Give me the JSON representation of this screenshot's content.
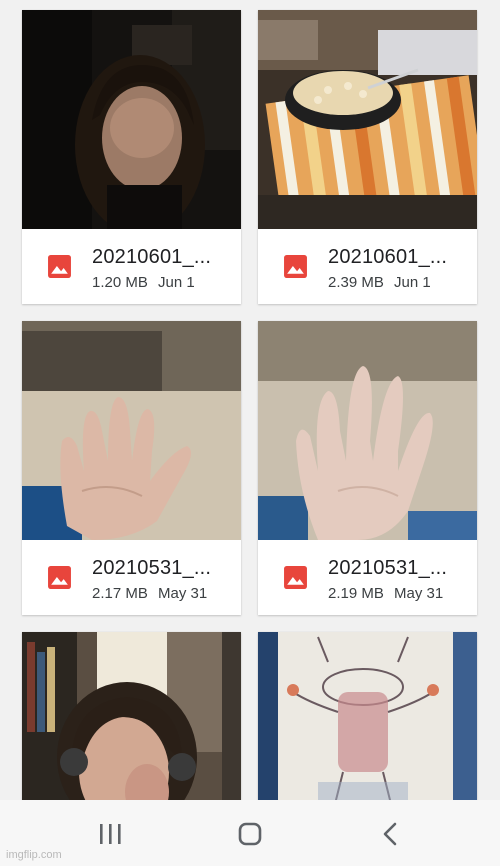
{
  "files": [
    {
      "name": "20210601_...",
      "size": "1.20 MB",
      "date": "Jun 1",
      "thumb": "portrait-dark-room-photo"
    },
    {
      "name": "20210601_...",
      "size": "2.39 MB",
      "date": "Jun 1",
      "thumb": "cereal-bowl-on-placemat-photo"
    },
    {
      "name": "20210531_...",
      "size": "2.17 MB",
      "date": "May 31",
      "thumb": "open-hand-photo"
    },
    {
      "name": "20210531_...",
      "size": "2.19 MB",
      "date": "May 31",
      "thumb": "open-hand-photo"
    },
    {
      "name": "",
      "size": "",
      "date": "",
      "thumb": "selfie-headphones-photo"
    },
    {
      "name": "",
      "size": "",
      "date": "",
      "thumb": "drawing-on-paper-photo"
    }
  ],
  "file_type_icon": "image-file-icon",
  "colors": {
    "background": "#f1f1f1",
    "card": "#ffffff",
    "image_icon": "#e8453c",
    "nav_bar": "#f7f7f7",
    "nav_icon": "#5f6368"
  },
  "nav": {
    "recents_icon": "recent-apps-icon",
    "home_icon": "home-icon",
    "back_icon": "back-icon"
  },
  "watermark": "imgflip.com"
}
